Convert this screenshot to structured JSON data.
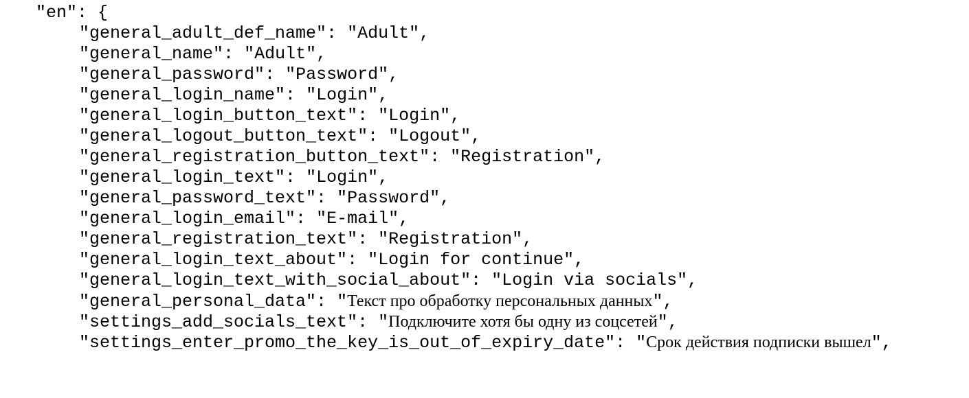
{
  "document": {
    "open_line": "\"en\": {",
    "entries": [
      {
        "key": "\"general_adult_def_name\":",
        "value": "\"Adult\","
      },
      {
        "key": "\"general_name\":",
        "value": "\"Adult\","
      },
      {
        "key": "\"general_password\":",
        "value": "\"Password\","
      },
      {
        "key": "\"general_login_name\":",
        "value": "\"Login\","
      },
      {
        "key": "\"general_login_button_text\":",
        "value": "\"Login\","
      },
      {
        "key": "\"general_logout_button_text\":",
        "value": "\"Logout\","
      },
      {
        "key": "\"general_registration_button_text\":",
        "value": "\"Registration\","
      },
      {
        "key": "\"general_login_text\":",
        "value": "\"Login\","
      },
      {
        "key": "\"general_password_text\":",
        "value": "\"Password\","
      },
      {
        "key": "\"general_login_email\":",
        "value": "\"E-mail\","
      },
      {
        "key": "\"general_registration_text\":",
        "value": "\"Registration\","
      },
      {
        "key": "\"general_login_text_about\":",
        "value": "\"Login for continue\","
      },
      {
        "key": "\"general_login_text_with_social_about\":",
        "value": "\"Login via socials\","
      },
      {
        "key": "\"general_personal_data\":",
        "value_open": "\"",
        "value": "Текст про обработку персональных данных",
        "value_close": "\","
      },
      {
        "key": "\"settings_add_socials_text\":",
        "value_open": "\"",
        "value": "Подключите хотя бы одну из соцсетей",
        "value_close": "\","
      },
      {
        "key": "\"settings_enter_promo_the_key_is_out_of_expiry_date\":",
        "value_open": "\"",
        "value": "Срок действия подписки вышел",
        "value_close": "\","
      }
    ]
  }
}
